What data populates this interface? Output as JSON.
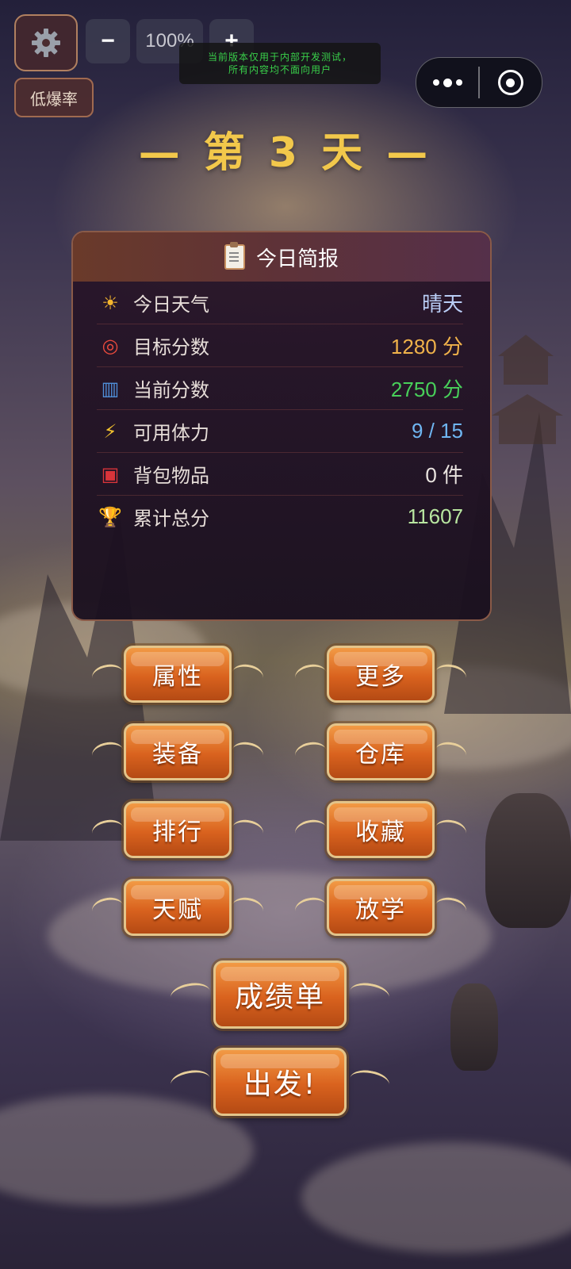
{
  "toolbar": {
    "settings_icon": "gear-icon",
    "zoom_out": "−",
    "zoom_level": "100%",
    "zoom_in": "+",
    "drop_rate": "低爆率"
  },
  "dev_notice": {
    "line1": "当前版本仅用于内部开发测试，",
    "line2": "所有内容均不面向用户"
  },
  "capsule": {
    "more_icon": "more-dots-icon",
    "close_icon": "target-close-icon"
  },
  "day_title": "— 第 3 天 —",
  "report": {
    "title": "今日简报",
    "rows": [
      {
        "icon": "sun-icon",
        "glyph": "☀",
        "label": "今日天气",
        "value": "晴天",
        "color": "#b9cdf5"
      },
      {
        "icon": "target-icon",
        "glyph": "◎",
        "label": "目标分数",
        "value": "1280 分",
        "color": "#f0b24a"
      },
      {
        "icon": "bar-chart-icon",
        "glyph": "▥",
        "label": "当前分数",
        "value": "2750 分",
        "color": "#48d05a"
      },
      {
        "icon": "lightning-icon",
        "glyph": "⚡",
        "label": "可用体力",
        "value": "9 / 15",
        "color": "#6fb6f2"
      },
      {
        "icon": "backpack-icon",
        "glyph": "▣",
        "label": "背包物品",
        "value": "0 件",
        "color": "#eae4e0"
      },
      {
        "icon": "trophy-icon",
        "glyph": "🏆",
        "label": "累计总分",
        "value": "11607",
        "color": "#b8e6a0"
      }
    ]
  },
  "menu": {
    "attributes": "属性",
    "more": "更多",
    "equipment": "装备",
    "warehouse": "仓库",
    "ranking": "排行",
    "collection": "收藏",
    "talent": "天赋",
    "after_school": "放学",
    "report_card": "成绩单",
    "depart": "出发!"
  }
}
